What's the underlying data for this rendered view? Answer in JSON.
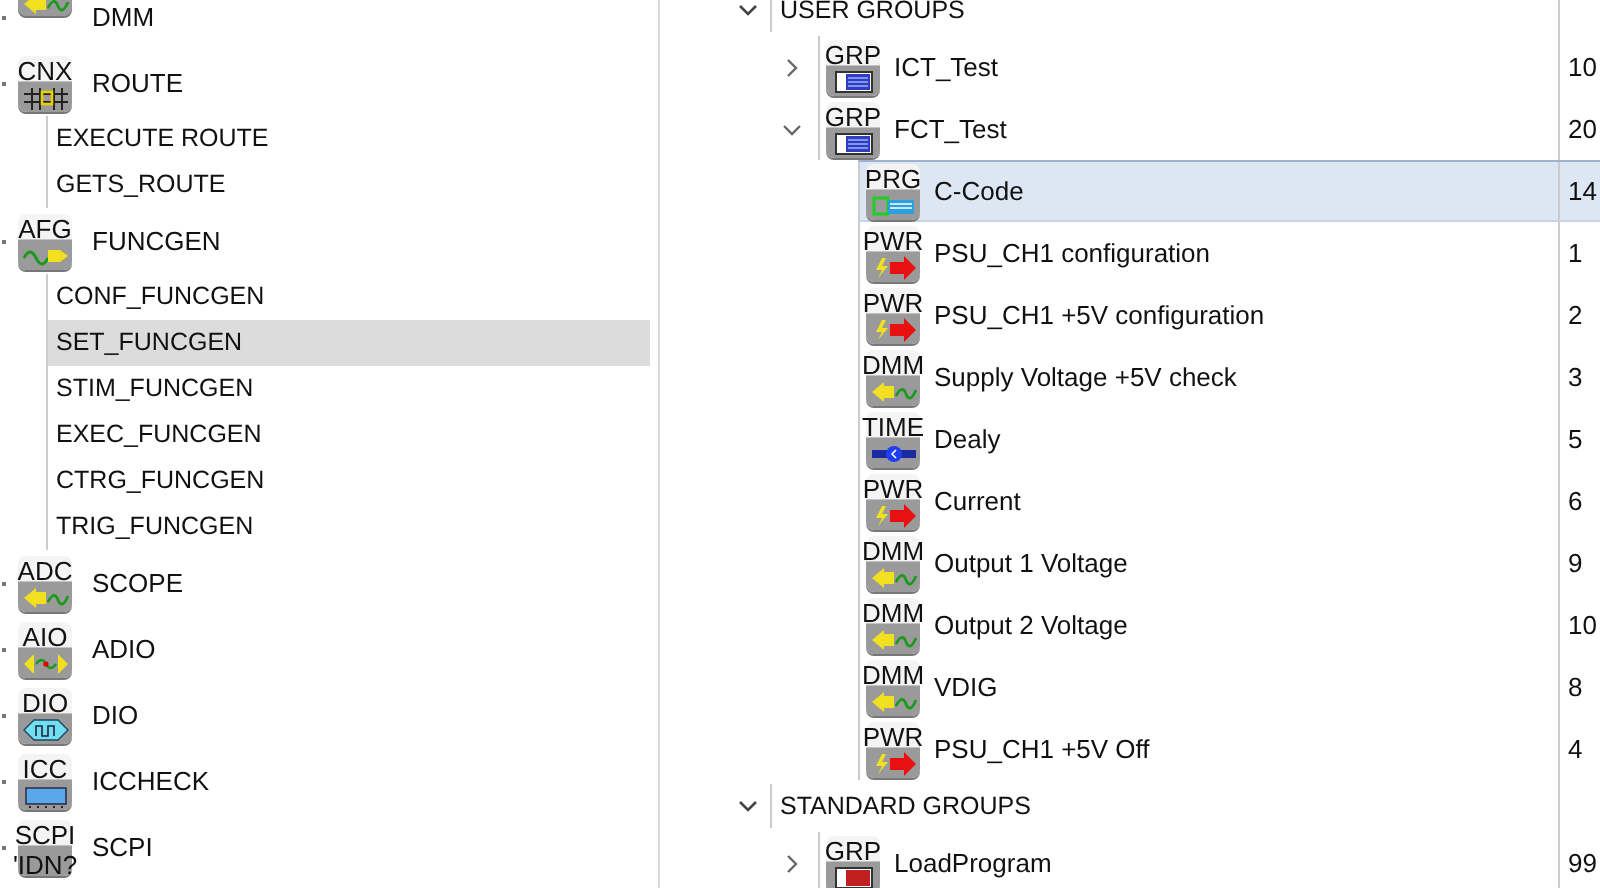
{
  "toolbox": {
    "categories": [
      {
        "kind": "dmm",
        "label": "DMM"
      },
      {
        "badge": "CNX",
        "kind": "cnx",
        "label": "ROUTE",
        "items": [
          {
            "label": "EXECUTE ROUTE",
            "selected": false
          },
          {
            "label": "GETS_ROUTE",
            "selected": false
          }
        ]
      },
      {
        "badge": "AFG",
        "kind": "afg",
        "label": "FUNCGEN",
        "items": [
          {
            "label": "CONF_FUNCGEN",
            "selected": false
          },
          {
            "label": "SET_FUNCGEN",
            "selected": true
          },
          {
            "label": "STIM_FUNCGEN",
            "selected": false
          },
          {
            "label": "EXEC_FUNCGEN",
            "selected": false
          },
          {
            "label": "CTRG_FUNCGEN",
            "selected": false
          },
          {
            "label": "TRIG_FUNCGEN",
            "selected": false
          }
        ]
      },
      {
        "badge": "ADC",
        "kind": "adc",
        "label": "SCOPE"
      },
      {
        "badge": "AIO",
        "kind": "aio",
        "label": "ADIO"
      },
      {
        "badge": "DIO",
        "kind": "dio",
        "label": "DIO"
      },
      {
        "badge": "ICC",
        "kind": "icc",
        "label": "ICCHECK"
      },
      {
        "badge": "SCPI",
        "kind": "scpi",
        "sub": "'IDN?",
        "label": "SCPI"
      }
    ]
  },
  "sequence": {
    "sections": [
      {
        "title": "USER GROUPS",
        "expanded": true,
        "groups": [
          {
            "badge": "GRP",
            "kind": "grp",
            "name": "ICT_Test",
            "value": "10",
            "expanded": false
          },
          {
            "badge": "GRP",
            "kind": "grp",
            "name": "FCT_Test",
            "value": "20",
            "expanded": true,
            "steps": [
              {
                "badge": "PRG",
                "kind": "prg",
                "name": "C-Code",
                "value": "14",
                "selected": true
              },
              {
                "badge": "PWR",
                "kind": "pwr",
                "name": "PSU_CH1 configuration",
                "value": "1",
                "selected": false
              },
              {
                "badge": "PWR",
                "kind": "pwr",
                "name": "PSU_CH1 +5V configuration",
                "value": "2",
                "selected": false
              },
              {
                "badge": "DMM",
                "kind": "dmm",
                "name": "Supply Voltage +5V check",
                "value": "3",
                "selected": false
              },
              {
                "badge": "TIME",
                "kind": "time",
                "name": "Dealy",
                "value": "5",
                "selected": false
              },
              {
                "badge": "PWR",
                "kind": "pwr",
                "name": "Current",
                "value": "6",
                "selected": false
              },
              {
                "badge": "DMM",
                "kind": "dmm",
                "name": "Output 1 Voltage",
                "value": "9",
                "selected": false
              },
              {
                "badge": "DMM",
                "kind": "dmm",
                "name": "Output 2 Voltage",
                "value": "10",
                "selected": false
              },
              {
                "badge": "DMM",
                "kind": "dmm",
                "name": "VDIG",
                "value": "8",
                "selected": false
              },
              {
                "badge": "PWR",
                "kind": "pwr",
                "name": "PSU_CH1 +5V Off",
                "value": "4",
                "selected": false
              }
            ]
          }
        ]
      },
      {
        "title": "STANDARD GROUPS",
        "expanded": true,
        "groups": [
          {
            "badge": "GRP",
            "kind": "grp_red",
            "name": "LoadProgram",
            "value": "99",
            "expanded": false
          }
        ]
      }
    ]
  }
}
